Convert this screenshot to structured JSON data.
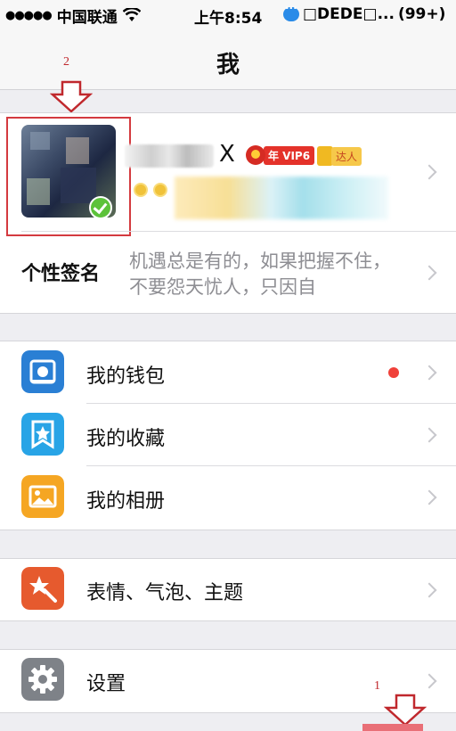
{
  "status_bar": {
    "carrier": "中国联通",
    "time": "上午8:54",
    "notification": "□DEDE□...",
    "count": "(99+)"
  },
  "nav": {
    "title": "我"
  },
  "annotations": {
    "label_1": "1",
    "label_2": "2"
  },
  "profile": {
    "name_suffix": "X",
    "vip_label": "年 VIP6",
    "daren_label": "达人"
  },
  "signature": {
    "label": "个性签名",
    "text": "机遇总是有的，如果把握不住，不要怨天忧人，只因自"
  },
  "menu_group_1": [
    {
      "label": "我的钱包",
      "icon": "wallet-icon",
      "has_dot": true
    },
    {
      "label": "我的收藏",
      "icon": "favorites-icon",
      "has_dot": false
    },
    {
      "label": "我的相册",
      "icon": "album-icon",
      "has_dot": false
    }
  ],
  "menu_group_2": [
    {
      "label": "表情、气泡、主题",
      "icon": "theme-icon"
    }
  ],
  "menu_group_3": [
    {
      "label": "设置",
      "icon": "settings-icon"
    }
  ],
  "colors": {
    "wallet": "#2a7fd4",
    "favorites": "#28a4e6",
    "album": "#f5a623",
    "theme": "#e65a2e",
    "settings": "#7e8288"
  }
}
